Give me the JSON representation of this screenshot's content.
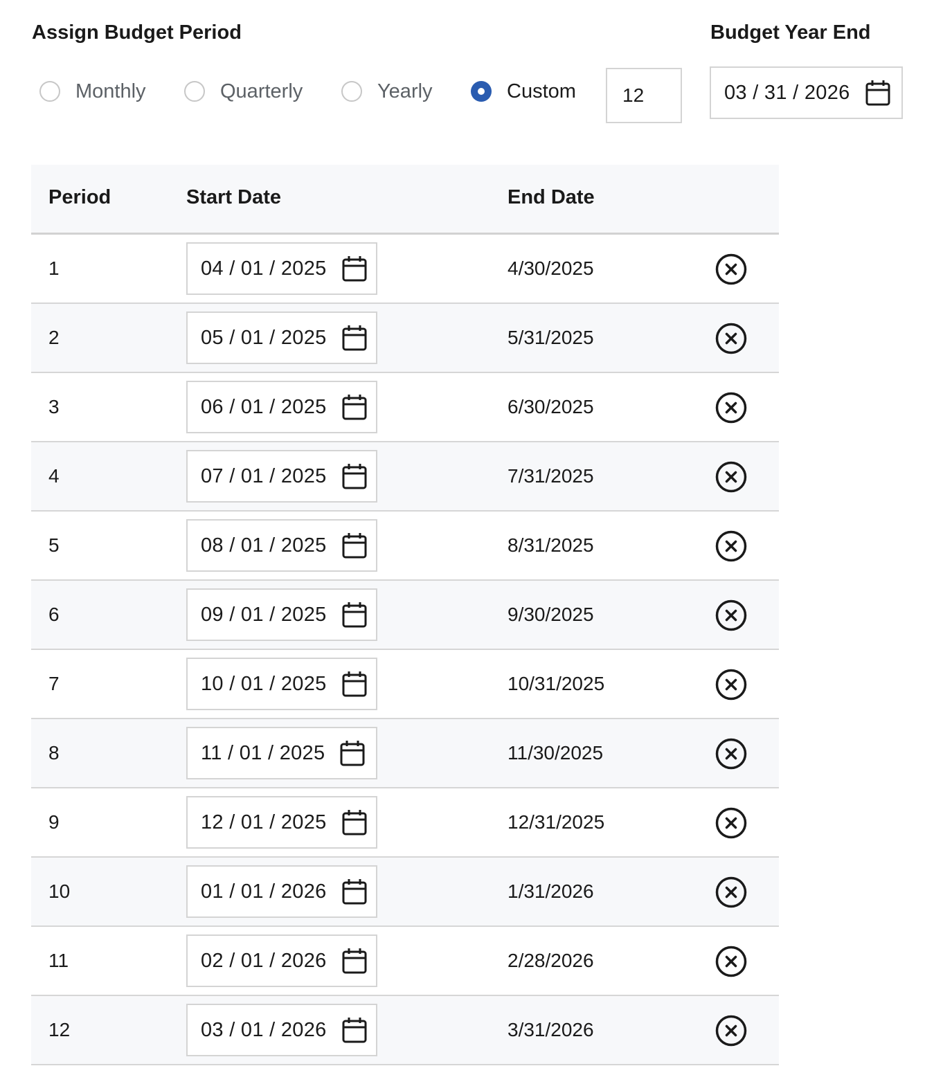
{
  "header": {
    "assign_title": "Assign Budget Period",
    "year_end_title": "Budget Year End"
  },
  "period_options": [
    {
      "label": "Monthly",
      "checked": false
    },
    {
      "label": "Quarterly",
      "checked": false
    },
    {
      "label": "Yearly",
      "checked": false
    },
    {
      "label": "Custom",
      "checked": true
    }
  ],
  "custom_count": "12",
  "budget_year_end": "03 / 31 / 2026",
  "colors": {
    "radio_selected": "#2a5cb0",
    "row_alt_bg": "#f7f8fa",
    "border": "#d4d4d4"
  },
  "icons": {
    "date_picker": "calendar-icon",
    "remove": "close-circle-icon"
  },
  "table": {
    "columns": [
      "Period",
      "Start Date",
      "End Date"
    ],
    "rows": [
      {
        "period": "1",
        "start": "04 / 01 / 2025",
        "end": "4/30/2025"
      },
      {
        "period": "2",
        "start": "05 / 01 / 2025",
        "end": "5/31/2025"
      },
      {
        "period": "3",
        "start": "06 / 01 / 2025",
        "end": "6/30/2025"
      },
      {
        "period": "4",
        "start": "07 / 01 / 2025",
        "end": "7/31/2025"
      },
      {
        "period": "5",
        "start": "08 / 01 / 2025",
        "end": "8/31/2025"
      },
      {
        "period": "6",
        "start": "09 / 01 / 2025",
        "end": "9/30/2025"
      },
      {
        "period": "7",
        "start": "10 / 01 / 2025",
        "end": "10/31/2025"
      },
      {
        "period": "8",
        "start": "11 / 01 / 2025",
        "end": "11/30/2025"
      },
      {
        "period": "9",
        "start": "12 / 01 / 2025",
        "end": "12/31/2025"
      },
      {
        "period": "10",
        "start": "01 / 01 / 2026",
        "end": "1/31/2026"
      },
      {
        "period": "11",
        "start": "02 / 01 / 2026",
        "end": "2/28/2026"
      },
      {
        "period": "12",
        "start": "03 / 01 / 2026",
        "end": "3/31/2026"
      }
    ]
  }
}
